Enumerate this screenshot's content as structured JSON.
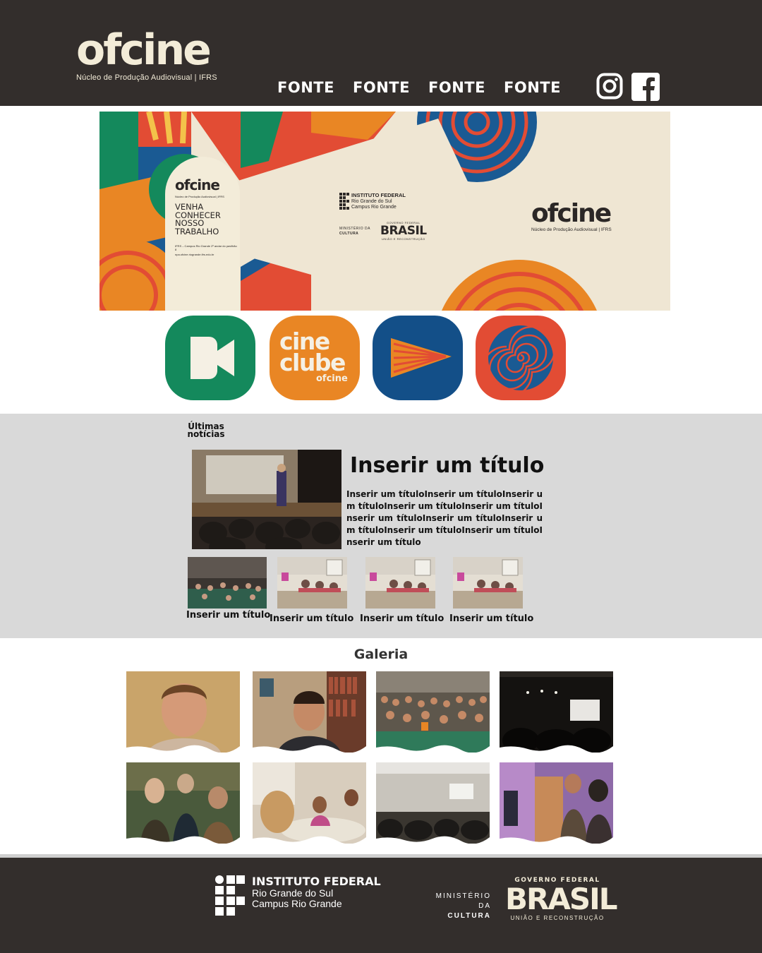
{
  "header": {
    "logo_word": "ofcine",
    "logo_sub": "Núcleo de Produção Audiovisual | IFRS",
    "nav": [
      "FONTE",
      "FONTE",
      "FONTE",
      "FONTE"
    ],
    "social": [
      "instagram-icon",
      "facebook-icon"
    ]
  },
  "banner": {
    "pill_logo": "ofcine",
    "pill_sub": "Núcleo de Produção Audiovisual | IFRS",
    "pill_text": "VENHA CONHECER NOSSO TRABALHO",
    "pill_address": "IFRS – Campus Rio Grande 2º andar do pavilhão 8",
    "pill_url": "npa.ofcine.riogrande.ifrs.edu.br",
    "if_name": "INSTITUTO FEDERAL",
    "if_line1": "Rio Grande do Sul",
    "if_line2": "Campus Rio Grande",
    "ministerio1": "MINISTÉRIO DA",
    "ministerio2": "CULTURA",
    "gov": "GOVERNO FEDERAL",
    "brasil": "BRASIL",
    "uniao": "UNIÃO E RECONSTRUÇÃO",
    "right_logo": "ofcine",
    "right_sub": "Núcleo de Produção Audiovisual | IFRS"
  },
  "tiles": {
    "cine1": "cine",
    "cine2": "clube",
    "cine3": "ofcine"
  },
  "news": {
    "heading": "Últimas notícias",
    "title": "Inserir um título",
    "body": "Inserir um títuloInserir um títuloInserir um títuloInserir um títuloInserir um títuloInserir um títuloInserir um títuloInserir um títuloInserir um títuloInserir um títuloInserir um título",
    "items": [
      {
        "caption": "Inserir um título"
      },
      {
        "caption": "Inserir um título"
      },
      {
        "caption": "Inserir um título"
      },
      {
        "caption": "Inserir um título"
      }
    ]
  },
  "gallery": {
    "title": "Galeria"
  },
  "footer": {
    "if_name": "INSTITUTO FEDERAL",
    "if_line1": "Rio Grande do Sul",
    "if_line2": "Campus Rio Grande",
    "ministerio1": "MINISTÉRIO DA",
    "ministerio2": "CULTURA",
    "gov": "GOVERNO FEDERAL",
    "brasil": "BRASIL",
    "uniao": "UNIÃO E RECONSTRUÇÃO"
  },
  "colors": {
    "header_bg": "#332e2c",
    "cream": "#f3ecd8",
    "green": "#14895c",
    "orange": "#e98624",
    "blue": "#134f88",
    "red": "#e24c34",
    "news_bg": "#d9d9d9"
  }
}
